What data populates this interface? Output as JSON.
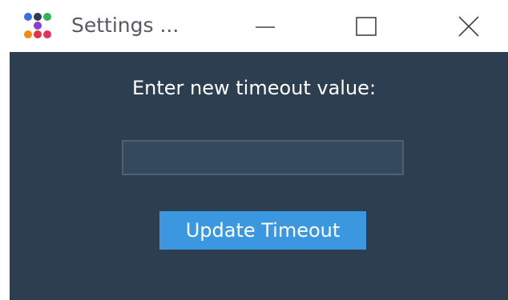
{
  "window": {
    "title": "Settings ...",
    "controls": {
      "minimize": "minimize-icon",
      "maximize": "maximize-icon",
      "close": "close-icon"
    },
    "app_icon": "colored-dots-app-icon"
  },
  "dialog": {
    "prompt": "Enter new timeout value:",
    "timeout_value": "",
    "update_button": "Update Timeout"
  },
  "colors": {
    "background": "#2c3e50",
    "input_background": "#34495e",
    "input_border": "#4e6276",
    "button": "#3a97e0",
    "text": "#ffffff"
  }
}
